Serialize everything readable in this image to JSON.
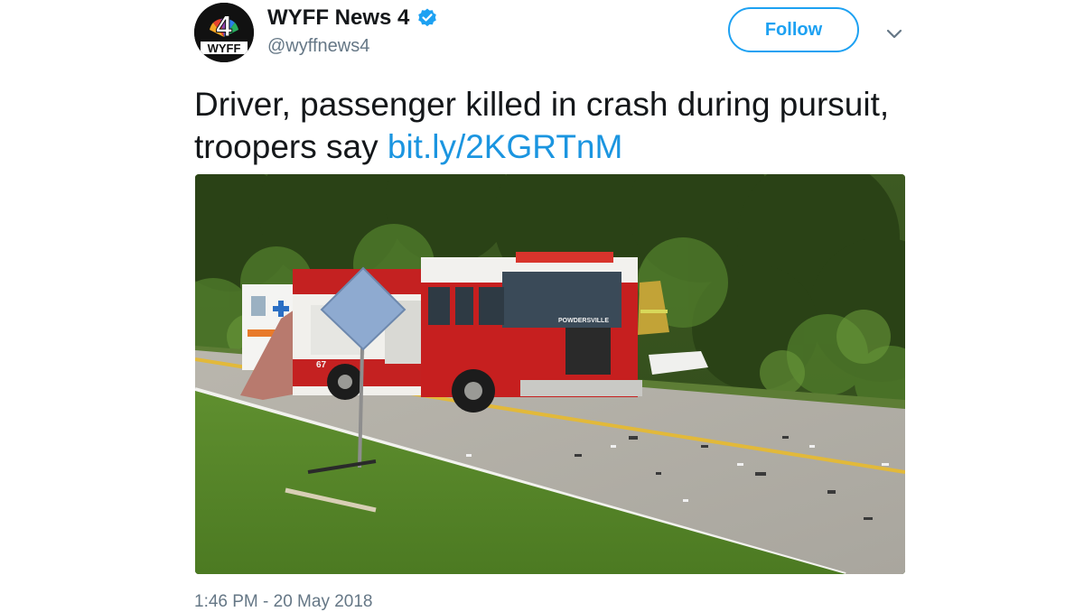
{
  "account": {
    "logo_number": "4",
    "logo_text": "WYFF",
    "display_name": "WYFF News 4",
    "verified_icon": "verified-badge-icon",
    "handle": "@wyffnews4"
  },
  "actions": {
    "follow_label": "Follow",
    "menu_icon": "chevron-down-icon"
  },
  "tweet": {
    "text": "Driver, passenger killed in crash during pursuit, troopers say ",
    "link": "bit.ly/2KGRTnM",
    "timestamp": "1:46 PM - 20 May 2018"
  },
  "photo": {
    "truck_text": "POWDERSVILLE",
    "truck_number": "67"
  },
  "colors": {
    "accent": "#1da1f2",
    "link": "#1b95e0",
    "muted": "#657786"
  }
}
